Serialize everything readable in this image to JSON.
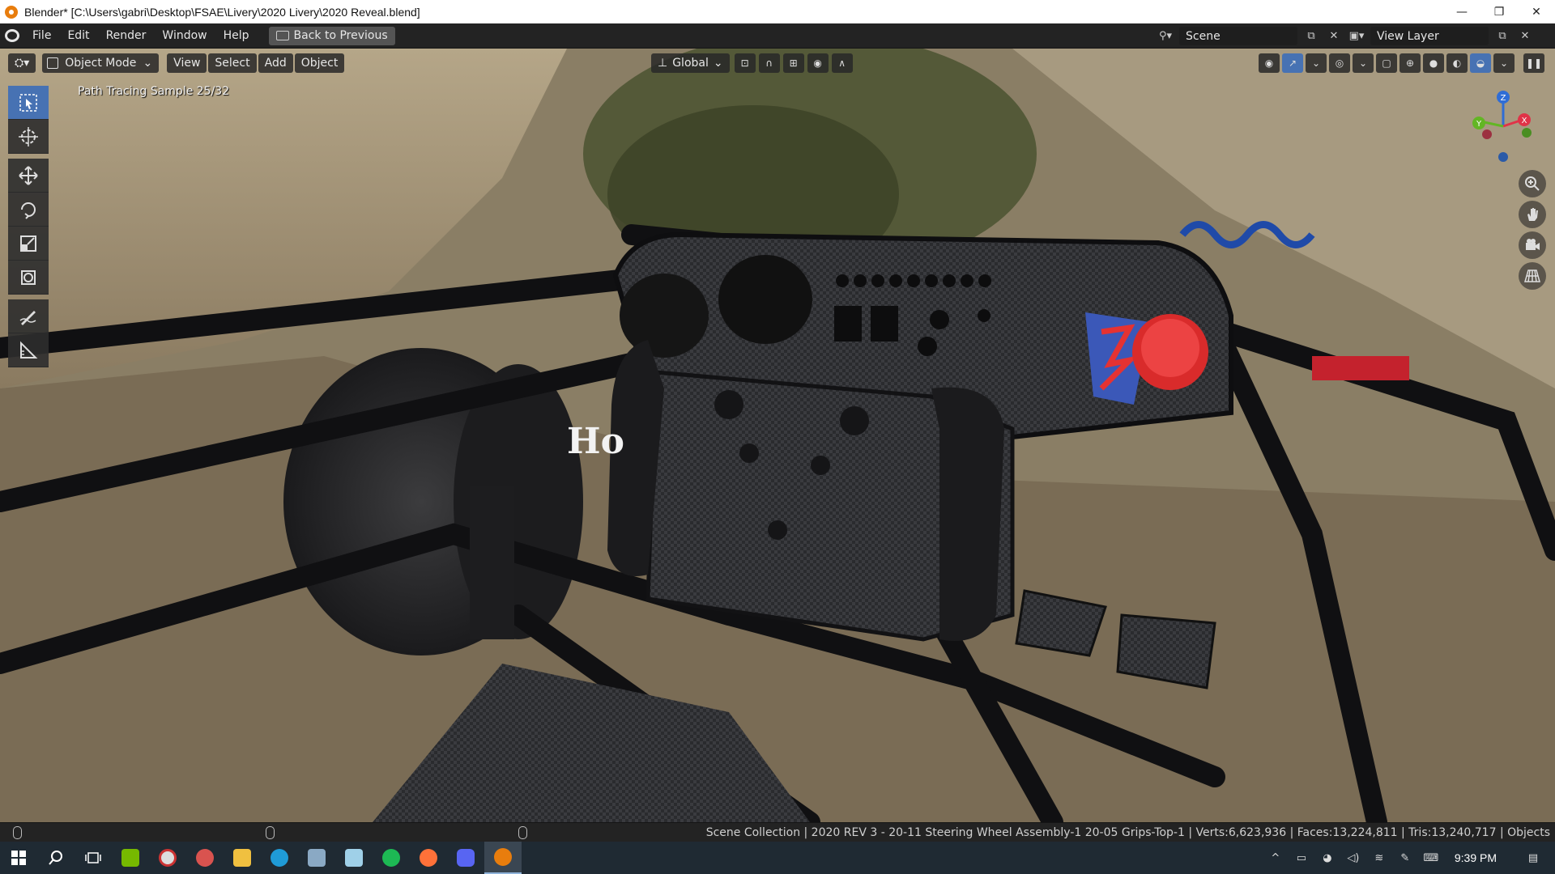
{
  "window": {
    "title": "Blender* [C:\\Users\\gabri\\Desktop\\FSAE\\Livery\\2020 Livery\\2020 Reveal.blend]",
    "minimize_glyph": "—",
    "maximize_glyph": "❐",
    "close_glyph": "✕"
  },
  "menubar": {
    "items": [
      "File",
      "Edit",
      "Render",
      "Window",
      "Help"
    ],
    "back_button": "Back to Previous",
    "scene_label": "Scene",
    "view_layer_label": "View Layer"
  },
  "viewport_header": {
    "mode": "Object Mode",
    "menus": [
      "View",
      "Select",
      "Add",
      "Object"
    ],
    "orientation": "Global"
  },
  "viewport": {
    "overlay_text": "Path Tracing Sample 25/32",
    "gizmo_axes": [
      "Z",
      "Y",
      "X"
    ],
    "accent_color": "#4772b3"
  },
  "toolbar": {
    "tools": [
      "select-box",
      "cursor",
      "move",
      "rotate",
      "scale",
      "transform",
      "annotate",
      "measure"
    ]
  },
  "statusbar": {
    "text": "Scene Collection | 2020 REV 3 - 20-11 Steering Wheel Assembly-1 20-05 Grips-Top-1 | Verts:6,623,936 | Faces:13,224,811 | Tris:13,240,717 | Objects"
  },
  "taskbar": {
    "clock": "9:39 PM",
    "apps": [
      "start",
      "search",
      "task-view",
      "nvidia",
      "app-red",
      "app-wave",
      "file-explorer",
      "edge",
      "mail",
      "notes",
      "spotify",
      "firefox",
      "discord",
      "blender"
    ]
  }
}
